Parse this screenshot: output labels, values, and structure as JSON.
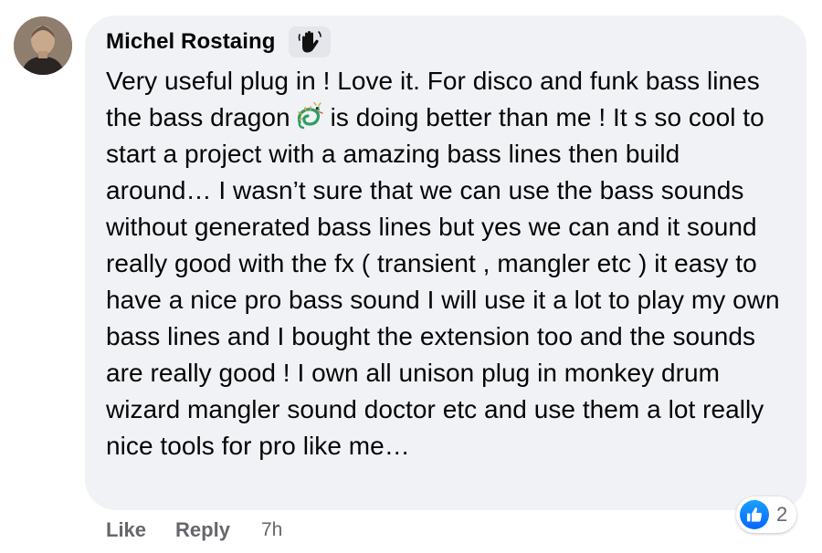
{
  "comment": {
    "author": "Michel Rostaing",
    "author_badge_icon": "waving-hand-icon",
    "text_before_emoji": "Very useful plug in ! Love it. For disco and funk bass lines the bass dragon",
    "inline_emoji": "dragon-emoji",
    "text_after_emoji": "is doing better than me ! It s so cool to start a project with a amazing bass lines then build around… I wasn’t sure that we can use the bass sounds without generated bass lines but yes we can and it sound really good with the fx ( transient , mangler etc ) it easy to have a nice pro bass sound I will use it a lot to play my own bass lines and I bought the extension too and the sounds are really good ! I own all unison plug in monkey drum wizard mangler sound doctor etc and use them a lot really nice tools for pro like me…"
  },
  "actions": {
    "like_label": "Like",
    "reply_label": "Reply",
    "timestamp": "7h"
  },
  "reactions": {
    "icon": "like-thumb-icon",
    "count": "2"
  },
  "colors": {
    "bubble_bg": "#f0f2f5",
    "secondary_text": "#65676b",
    "like_blue": "#0866ff"
  }
}
